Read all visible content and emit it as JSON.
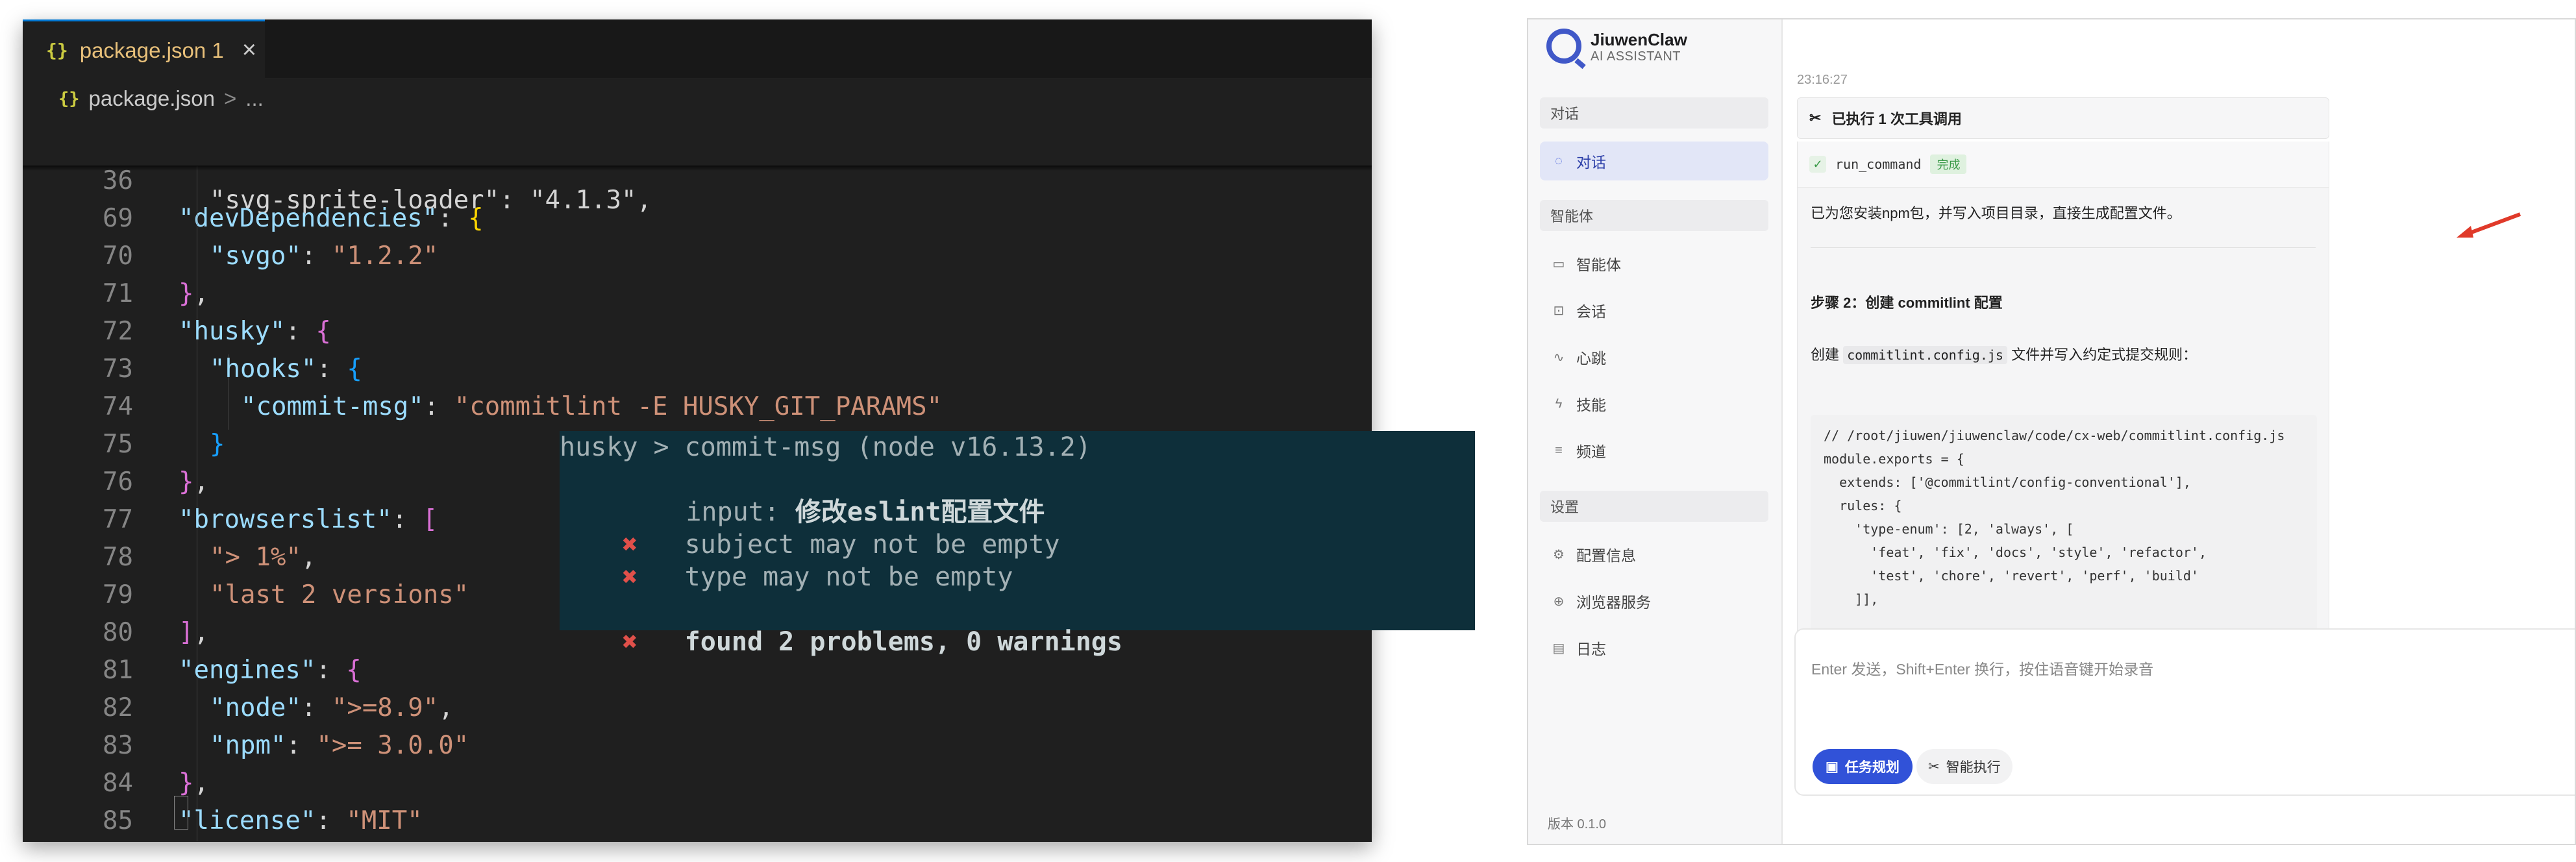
{
  "editor": {
    "tab": {
      "icon": "{}",
      "label": "package.json 1",
      "close": "×"
    },
    "breadcrumb": {
      "icon": "{}",
      "file": "package.json",
      "sep": ">",
      "more": "..."
    },
    "sticky_line": {
      "num": "36",
      "text": "\"devDependencies\": {"
    },
    "partial_line": "\"svg-sprite-loader\": \"4.1.3\",",
    "lines": [
      {
        "num": "69",
        "text": "\"svgo\": \"1.2.2\""
      },
      {
        "num": "70",
        "text": "},"
      },
      {
        "num": "71",
        "text": "\"husky\": {"
      },
      {
        "num": "72",
        "text": "\"hooks\": {"
      },
      {
        "num": "73",
        "text": "\"commit-msg\": \"commitlint -E HUSKY_GIT_PARAMS\""
      },
      {
        "num": "74",
        "text": "}"
      },
      {
        "num": "75",
        "text": "},"
      },
      {
        "num": "76",
        "text": "\"browserslist\": ["
      },
      {
        "num": "77",
        "text": "\"> 1%\","
      },
      {
        "num": "78",
        "text": "\"last 2 versions\""
      },
      {
        "num": "79",
        "text": "],"
      },
      {
        "num": "80",
        "text": "\"engines\": {"
      },
      {
        "num": "81",
        "text": "\"node\": \">=8.9\","
      },
      {
        "num": "82",
        "text": "\"npm\": \">= 3.0.0\""
      },
      {
        "num": "83",
        "text": "},"
      },
      {
        "num": "84",
        "text": "\"license\": \"MIT\""
      },
      {
        "num": "85",
        "text": "}"
      }
    ]
  },
  "terminal": {
    "header": "husky > commit-msg (node v16.13.2)",
    "input_label": "input:",
    "input_value": "修改eslint配置文件",
    "err1": "subject may not be empty",
    "err2": "type may not be empty",
    "summary": "found 2 problems, 0 warnings",
    "x_mark": "✖"
  },
  "app": {
    "brand": "JiuwenClaw",
    "brand_sub": "AI ASSISTANT",
    "sections": {
      "chat": "对话",
      "agents": "智能体",
      "settings": "设置"
    },
    "nav": {
      "chat": "对话",
      "agent": "智能体",
      "session": "会话",
      "heartbeat": "心跳",
      "skills": "技能",
      "channels": "频道",
      "config": "配置信息",
      "browser": "浏览器服务",
      "logs": "日志"
    },
    "version": "版本 0.1.0",
    "timestamp": "23:16:27",
    "tool_summary": "已执行 1 次工具调用",
    "tool_cmd": "run_command",
    "tool_status": "完成",
    "reply_line1": "已为您安装npm包，并写入项目目录，直接生成配置文件。",
    "step_title": "步骤 2：创建 commitlint 配置",
    "step_desc_pre": "创建",
    "step_desc_code": "commitlint.config.js",
    "step_desc_post": "文件并写入约定式提交规则：",
    "code_lines": [
      "// /root/jiuwen/jiuwenclaw/code/cx-web/commitlint.config.js",
      "module.exports = {",
      "  extends: ['@commitlint/config-conventional'],",
      "  rules: {",
      "    'type-enum': [2, 'always', [",
      "      'feat', 'fix', 'docs', 'style', 'refactor',",
      "      'test', 'chore', 'revert', 'perf', 'build'",
      "    ]],"
    ],
    "input_placeholder": "Enter 发送，Shift+Enter 换行，按住语音键开始录音",
    "btn_plan": "任务规划",
    "btn_exec": "智能执行",
    "accent": "#3152d8",
    "arrow_color": "#e03a2a"
  }
}
